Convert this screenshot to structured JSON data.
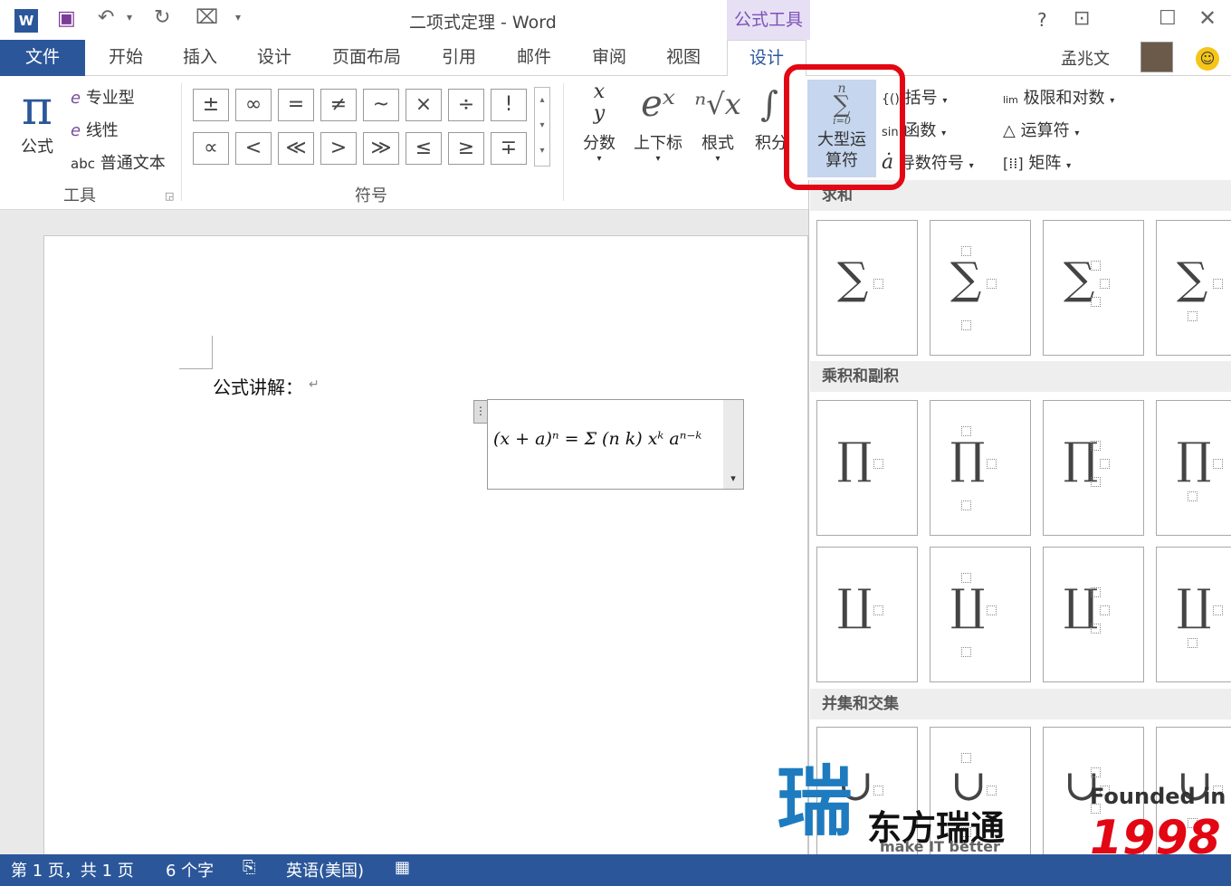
{
  "window": {
    "title": "二项式定理 - Word",
    "context_tab": "公式工具",
    "help": "?",
    "user": "孟兆文"
  },
  "tabs": {
    "file": "文件",
    "home": "开始",
    "insert": "插入",
    "design1": "设计",
    "layout": "页面布局",
    "references": "引用",
    "mailings": "邮件",
    "review": "审阅",
    "view": "视图",
    "design2": "设计"
  },
  "ribbon": {
    "tools": {
      "equation": "公式",
      "professional": "专业型",
      "linear": "线性",
      "normal_text": "普通文本",
      "group": "工具"
    },
    "symbols": {
      "group": "符号",
      "row1": [
        "±",
        "∞",
        "=",
        "≠",
        "~",
        "×",
        "÷",
        "!"
      ],
      "row2": [
        "∝",
        "<",
        "≪",
        ">",
        "≫",
        "≤",
        "≥",
        "∓"
      ]
    },
    "structures": {
      "fraction": "分数",
      "script": "上下标",
      "radical": "根式",
      "integral": "积分",
      "large_operator": "大型运算符",
      "bracket": "括号",
      "function": "函数",
      "accent": "导数符号",
      "limit_log": "极限和对数",
      "operator": "运算符",
      "matrix": "矩阵"
    }
  },
  "document": {
    "text": "公式讲解：",
    "equation": "(x + a)ⁿ = Σ (n k) xᵏ aⁿ⁻ᵏ"
  },
  "gallery": {
    "sections": [
      "求和",
      "乘积和副积",
      "并集和交集"
    ]
  },
  "watermark": {
    "brand": "东方瑞通",
    "slogan": "make IT better",
    "founded": "Founded in",
    "year": "1998"
  },
  "status": {
    "page": "第 1 页，共 1 页",
    "words": "6 个字",
    "language": "英语(美国)"
  },
  "colors": {
    "accent": "#2b579a",
    "highlight": "#e30613",
    "context": "#7d52b8"
  }
}
